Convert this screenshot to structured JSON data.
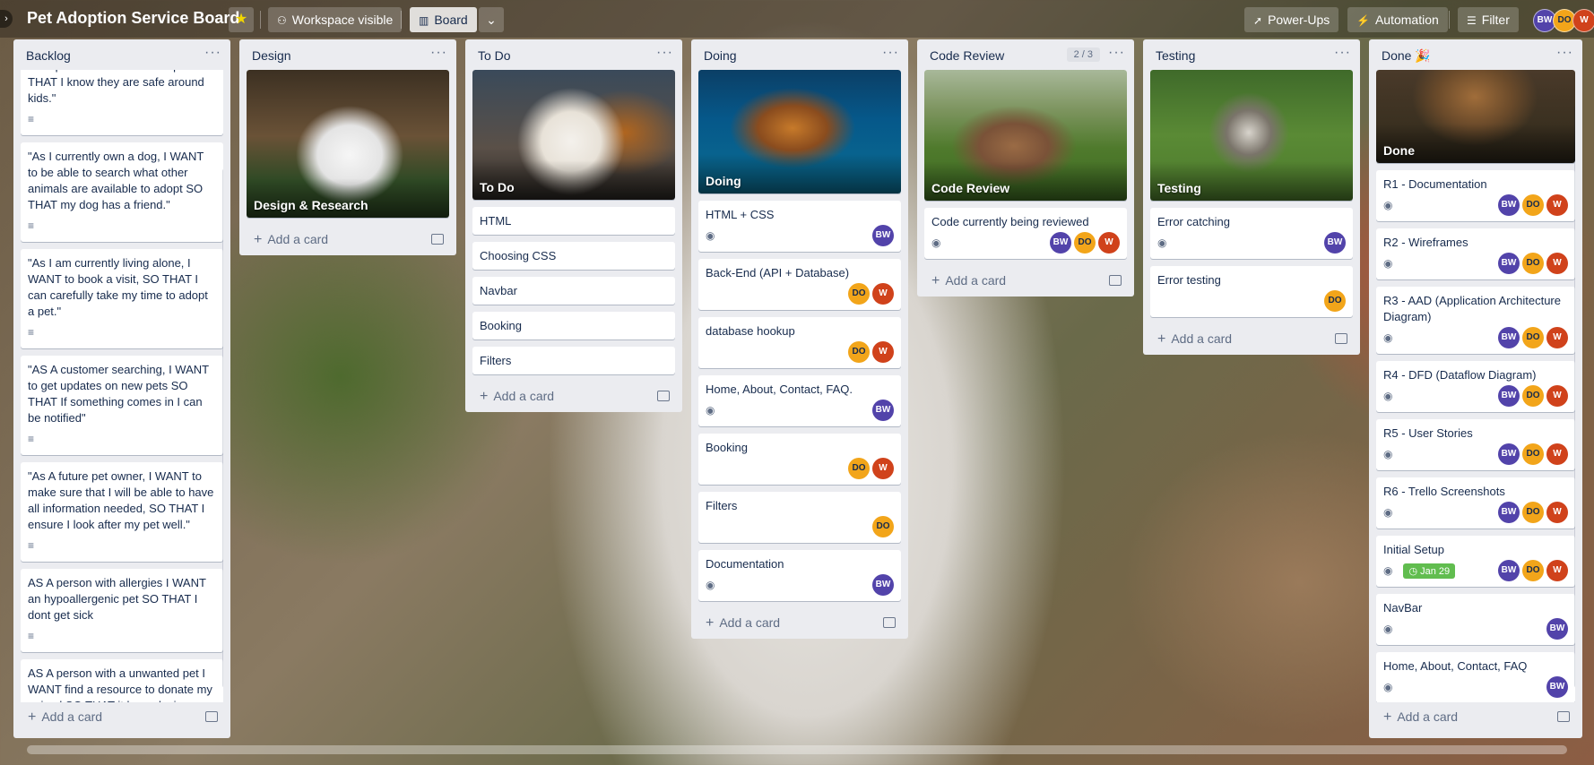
{
  "header": {
    "board_title": "Pet Adoption Service Board",
    "workspace_label": "Workspace visible",
    "board_view_label": "Board",
    "powerups_label": "Power-Ups",
    "automation_label": "Automation",
    "filter_label": "Filter",
    "members": [
      "BW",
      "DO",
      "W"
    ]
  },
  "colors": {
    "bw": "#5243aa",
    "do": "#f2a51a",
    "w": "#d0421b",
    "list_bg": "#ebecf0"
  },
  "lists": {
    "backlog": {
      "title": "Backlog",
      "add_label": "Add a card",
      "cards": [
        "\"As I parent I WANT to filter pets SO THAT I know they are safe around kids.\"",
        "\"As I currently own a dog, I WANT to be able to search what other animals are available to adopt SO THAT my dog has a friend.\"",
        "\"As I am currently living alone, I WANT to book a visit, SO THAT I can carefully take my time to adopt a pet.\"",
        "\"AS A customer searching, I WANT to get updates on new pets SO THAT If something comes in I can be notified\"",
        "\"As A future pet owner, I WANT to make sure that I will be able to have all information needed, SO THAT I ensure I look after my pet well.\"",
        "AS A person with allergies I WANT an hypoallergenic pet SO THAT I dont get sick",
        "AS A person with a unwanted pet I WANT find a resource to donate my animal SO THAT it has a loving home"
      ]
    },
    "design": {
      "title": "Design",
      "cover_title": "Design & Research",
      "add_label": "Add a card"
    },
    "todo": {
      "title": "To Do",
      "cover_title": "To Do",
      "add_label": "Add a card",
      "cards": [
        "HTML",
        "Choosing CSS",
        "Navbar",
        "Booking",
        "Filters"
      ]
    },
    "doing": {
      "title": "Doing",
      "cover_title": "Doing",
      "add_label": "Add a card",
      "cards": [
        {
          "title": "HTML + CSS",
          "members": [
            "BW"
          ]
        },
        {
          "title": "Back-End (API + Database)",
          "members": [
            "DO",
            "W"
          ]
        },
        {
          "title": "database hookup",
          "members": [
            "DO",
            "W"
          ]
        },
        {
          "title": "Home, About, Contact, FAQ.",
          "members": [
            "BW"
          ]
        },
        {
          "title": "Booking",
          "members": [
            "DO",
            "W"
          ]
        },
        {
          "title": "Filters",
          "members": [
            "DO"
          ]
        },
        {
          "title": "Documentation",
          "members": [
            "BW"
          ]
        }
      ]
    },
    "code_review": {
      "title": "Code Review",
      "wip": "2 / 3",
      "cover_title": "Code Review",
      "add_label": "Add a card",
      "cards": [
        {
          "title": "Code currently being reviewed",
          "members": [
            "BW",
            "DO",
            "W"
          ]
        }
      ]
    },
    "testing": {
      "title": "Testing",
      "cover_title": "Testing",
      "add_label": "Add a card",
      "cards": [
        {
          "title": "Error catching",
          "members": [
            "BW"
          ]
        },
        {
          "title": "Error testing",
          "members": [
            "DO"
          ]
        }
      ]
    },
    "done": {
      "title": "Done 🎉",
      "cover_title": "Done",
      "add_label": "Add a card",
      "cards": [
        {
          "title": "R1 - Documentation",
          "members": [
            "BW",
            "DO",
            "W"
          ]
        },
        {
          "title": "R2 - Wireframes",
          "members": [
            "BW",
            "DO",
            "W"
          ]
        },
        {
          "title": "R3 - AAD (Application Architecture Diagram)",
          "members": [
            "BW",
            "DO",
            "W"
          ]
        },
        {
          "title": "R4 - DFD (Dataflow Diagram)",
          "members": [
            "BW",
            "DO",
            "W"
          ]
        },
        {
          "title": "R5 - User Stories",
          "members": [
            "BW",
            "DO",
            "W"
          ]
        },
        {
          "title": "R6 - Trello Screenshots",
          "members": [
            "BW",
            "DO",
            "W"
          ]
        },
        {
          "title": "Initial Setup",
          "date": "Jan 29",
          "members": [
            "BW",
            "DO",
            "W"
          ]
        },
        {
          "title": "NavBar",
          "members": [
            "BW"
          ]
        },
        {
          "title": "Home, About, Contact, FAQ",
          "members": [
            "BW"
          ]
        }
      ]
    }
  }
}
